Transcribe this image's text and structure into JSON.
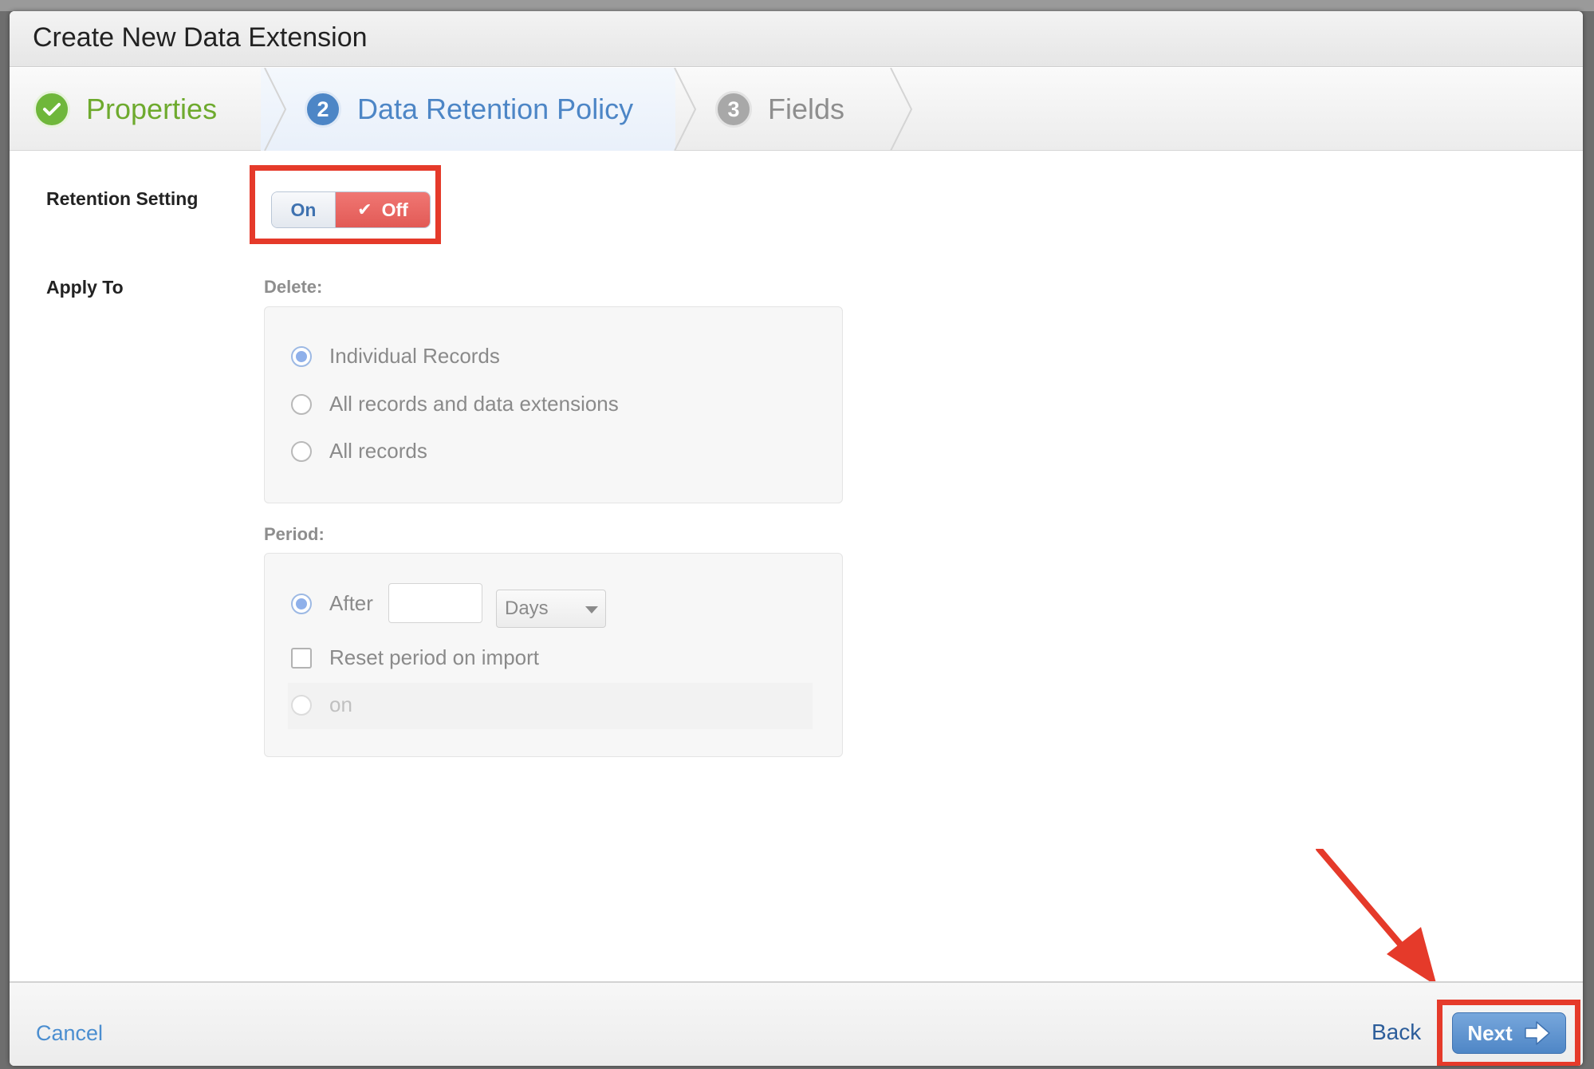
{
  "dialog": {
    "title": "Create New Data Extension"
  },
  "steps": [
    {
      "number": "",
      "label": "Properties",
      "state": "done"
    },
    {
      "number": "2",
      "label": "Data Retention Policy",
      "state": "active"
    },
    {
      "number": "3",
      "label": "Fields",
      "state": "todo"
    }
  ],
  "retention": {
    "label": "Retention Setting",
    "on_label": "On",
    "off_label": "Off",
    "selected": "Off"
  },
  "apply_to": {
    "label": "Apply To",
    "delete_label": "Delete:",
    "delete_options": [
      {
        "label": "Individual Records",
        "selected": true
      },
      {
        "label": "All records and data extensions",
        "selected": false
      },
      {
        "label": "All records",
        "selected": false
      }
    ],
    "period_label": "Period:",
    "after_label": "After",
    "after_value": "",
    "unit_selected": "Days",
    "reset_label": "Reset period on import",
    "reset_checked": false,
    "on_label": "on"
  },
  "footer": {
    "cancel_label": "Cancel",
    "back_label": "Back",
    "next_label": "Next"
  },
  "colors": {
    "annotation_red": "#e53a2a",
    "step_done_green": "#6fb73b",
    "step_active_blue": "#4d86c6",
    "toggle_off_red": "#e25a56"
  }
}
